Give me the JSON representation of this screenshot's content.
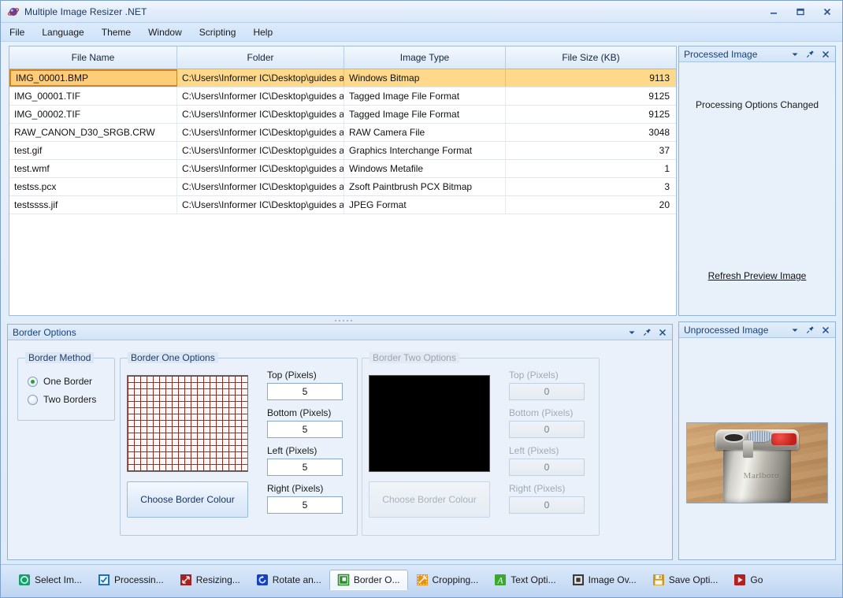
{
  "window": {
    "title": "Multiple Image Resizer .NET",
    "icon": "app-icon",
    "controls": {
      "minimize": "minimize-icon",
      "maximize": "maximize-icon",
      "close": "close-icon"
    }
  },
  "menu": {
    "items": [
      "File",
      "Language",
      "Theme",
      "Window",
      "Scripting",
      "Help"
    ]
  },
  "file_grid": {
    "columns": [
      "File Name",
      "Folder",
      "Image Type",
      "File Size (KB)"
    ],
    "rows": [
      {
        "name": "IMG_00001.BMP",
        "folder": "C:\\Users\\Informer IC\\Desktop\\guides a...",
        "type": "Windows Bitmap",
        "size": "9113",
        "selected": true
      },
      {
        "name": "IMG_00001.TIF",
        "folder": "C:\\Users\\Informer IC\\Desktop\\guides a...",
        "type": "Tagged Image File Format",
        "size": "9125",
        "selected": false
      },
      {
        "name": "IMG_00002.TIF",
        "folder": "C:\\Users\\Informer IC\\Desktop\\guides a...",
        "type": "Tagged Image File Format",
        "size": "9125",
        "selected": false
      },
      {
        "name": "RAW_CANON_D30_SRGB.CRW",
        "folder": "C:\\Users\\Informer IC\\Desktop\\guides a...",
        "type": "RAW Camera File",
        "size": "3048",
        "selected": false
      },
      {
        "name": "test.gif",
        "folder": "C:\\Users\\Informer IC\\Desktop\\guides a...",
        "type": "Graphics Interchange Format",
        "size": "37",
        "selected": false
      },
      {
        "name": "test.wmf",
        "folder": "C:\\Users\\Informer IC\\Desktop\\guides a...",
        "type": "Windows Metafile",
        "size": "1",
        "selected": false
      },
      {
        "name": "testss.pcx",
        "folder": "C:\\Users\\Informer IC\\Desktop\\guides a...",
        "type": "Zsoft Paintbrush PCX Bitmap",
        "size": "3",
        "selected": false
      },
      {
        "name": "testssss.jif",
        "folder": "C:\\Users\\Informer IC\\Desktop\\guides a...",
        "type": "JPEG Format",
        "size": "20",
        "selected": false
      }
    ]
  },
  "processed_panel": {
    "title": "Processed Image",
    "message": "Processing Options Changed",
    "refresh_link": "Refresh Preview Image"
  },
  "unprocessed_panel": {
    "title": "Unprocessed Image",
    "photo_brand": "Marlboro"
  },
  "border_options": {
    "title": "Border Options",
    "method_group": {
      "title": "Border Method",
      "options": [
        {
          "label": "One Border",
          "selected": true
        },
        {
          "label": "Two Borders",
          "selected": false
        }
      ]
    },
    "border_one": {
      "title": "Border One Options",
      "choose_colour_label": "Choose Border Colour",
      "enabled": true,
      "fields": [
        {
          "label": "Top (Pixels)",
          "value": "5"
        },
        {
          "label": "Bottom (Pixels)",
          "value": "5"
        },
        {
          "label": "Left (Pixels)",
          "value": "5"
        },
        {
          "label": "Right (Pixels)",
          "value": "5"
        }
      ]
    },
    "border_two": {
      "title": "Border Two Options",
      "choose_colour_label": "Choose Border Colour",
      "enabled": false,
      "swatch_colour": "#000000",
      "fields": [
        {
          "label": "Top (Pixels)",
          "value": "0"
        },
        {
          "label": "Bottom (Pixels)",
          "value": "0"
        },
        {
          "label": "Left (Pixels)",
          "value": "0"
        },
        {
          "label": "Right (Pixels)",
          "value": "0"
        }
      ]
    }
  },
  "tabs": [
    {
      "label": "Select Im...",
      "icon": "select-images-icon",
      "color": "#13a06e",
      "active": false
    },
    {
      "label": "Processin...",
      "icon": "processing-options-icon",
      "color": "#1b6fc4",
      "active": false
    },
    {
      "label": "Resizing...",
      "icon": "resizing-icon",
      "color": "#a32323",
      "active": false
    },
    {
      "label": "Rotate an...",
      "icon": "rotate-icon",
      "color": "#1340c4",
      "active": false
    },
    {
      "label": "Border O...",
      "icon": "border-options-icon",
      "color": "#2c8c2c",
      "active": true
    },
    {
      "label": "Cropping...",
      "icon": "cropping-icon",
      "color": "#e8900f",
      "active": false
    },
    {
      "label": "Text Opti...",
      "icon": "text-options-icon",
      "color": "#3aa82e",
      "active": false
    },
    {
      "label": "Image Ov...",
      "icon": "image-overlay-icon",
      "color": "#3b3b3b",
      "active": false
    },
    {
      "label": "Save Opti...",
      "icon": "save-options-icon",
      "color": "#c79a28",
      "active": false
    },
    {
      "label": "Go",
      "icon": "go-icon",
      "color": "#b61f1f",
      "active": false
    }
  ],
  "dock_controls": {
    "dropdown": "chevron-down-icon",
    "pin": "pin-icon",
    "close": "close-icon"
  }
}
